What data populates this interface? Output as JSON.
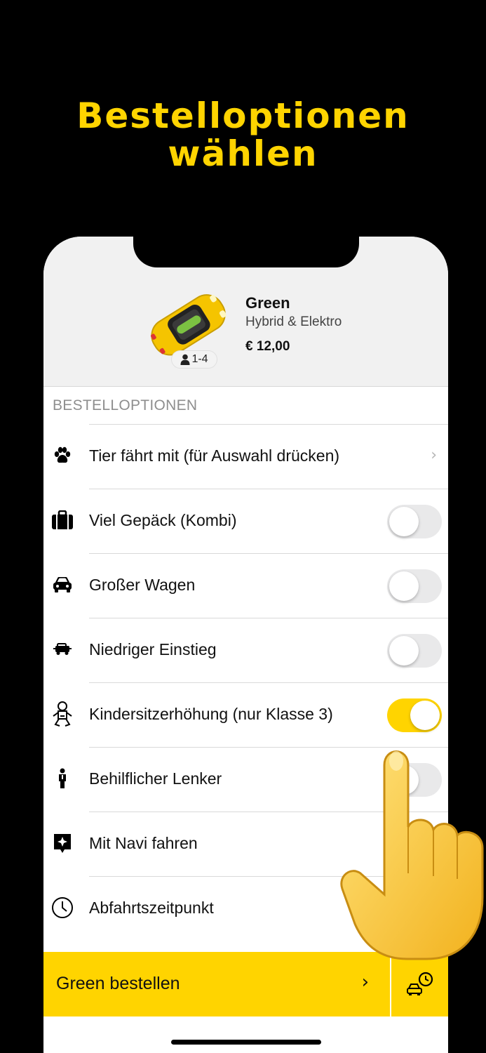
{
  "headline": {
    "line1": "Bestelloptionen",
    "line2": "wählen"
  },
  "car": {
    "name": "Green",
    "subtitle": "Hybrid & Elektro",
    "price": "€ 12,00",
    "passengers": "1-4",
    "passengers_icon": "person-icon",
    "image": "yellow-taxi-car"
  },
  "section_title": "BESTELLOPTIONEN",
  "options": [
    {
      "label": "Tier fährt mit (für Auswahl drücken)",
      "icon": "paw-icon",
      "control": "chevron",
      "chevron": "›"
    },
    {
      "label": "Viel Gepäck (Kombi)",
      "icon": "suitcase-icon",
      "control": "toggle",
      "enabled": false
    },
    {
      "label": "Großer Wagen",
      "icon": "car-icon",
      "control": "toggle",
      "enabled": false
    },
    {
      "label": "Niedriger Einstieg",
      "icon": "low-vehicle-icon",
      "control": "toggle",
      "enabled": false
    },
    {
      "label": "Kindersitzerhöhung (nur Klasse 3)",
      "icon": "baby-icon",
      "control": "toggle",
      "enabled": true
    },
    {
      "label": "Behilflicher Lenker",
      "icon": "driver-icon",
      "control": "toggle",
      "enabled": false
    },
    {
      "label": "Mit Navi fahren",
      "icon": "navigation-icon",
      "control": "toggle",
      "enabled": false
    },
    {
      "label": "Abfahrtszeitpunkt",
      "icon": "clock-icon",
      "control": "none"
    }
  ],
  "order_button": {
    "label": "Green bestellen",
    "chevron": "›"
  },
  "schedule_button": {
    "icon": "car-schedule-icon"
  },
  "overlay": {
    "icon": "pointing-hand-icon"
  },
  "colors": {
    "accent": "#FFD400",
    "background": "#000000",
    "text": "#111111",
    "muted": "#8E8E8E"
  }
}
